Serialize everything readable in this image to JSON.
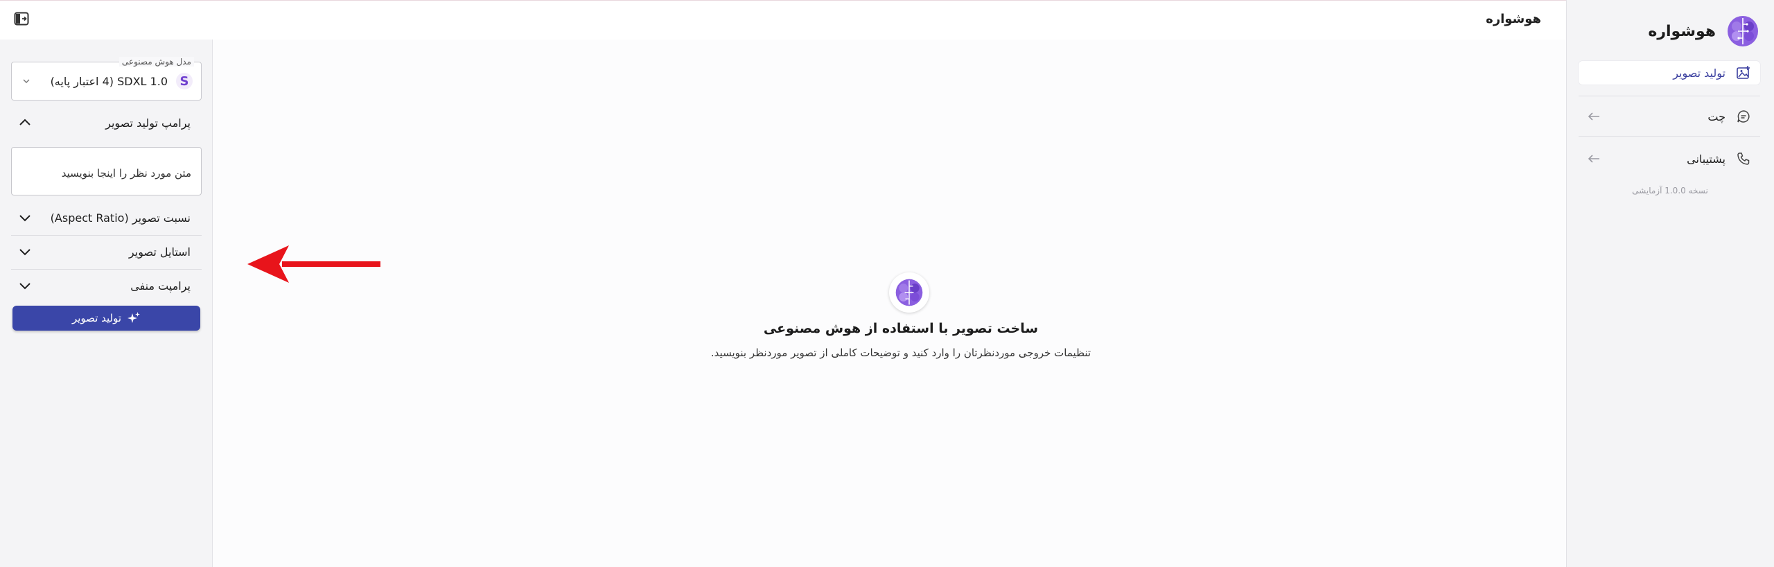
{
  "app": {
    "brand_name": "هوشواره",
    "header_title": "هوشواره",
    "version_label": "نسخه 1.0.0 آزمایشی"
  },
  "nav": {
    "items": [
      {
        "label": "تولید تصویر",
        "icon": "image-plus-icon",
        "active": true
      },
      {
        "label": "چت",
        "icon": "chat-icon",
        "active": false
      },
      {
        "label": "پشتیبانی",
        "icon": "phone-icon",
        "active": false
      }
    ]
  },
  "left_panel": {
    "model": {
      "legend": "مدل هوش مصنوعی",
      "value": "SDXL 1.0 (4 اعتبار پایه)",
      "icon_letter": "S"
    },
    "sections": {
      "prompt": "پرامپ تولید تصویر",
      "aspect_ratio": "نسبت تصویر (Aspect Ratio)",
      "style": "استایل تصویر",
      "negative_prompt": "پرامپت منفی"
    },
    "prompt_placeholder": "متن مورد نظر را اینجا بنویسید",
    "generate_button": "تولید تصویر"
  },
  "main": {
    "empty_title": "ساخت تصویر با استفاده از هوش مصنوعی",
    "empty_subtitle": "تنظیمات خروجی موردنظرتان را وارد کنید و توضیحات کاملی از تصویر موردنظر بنویسید."
  },
  "colors": {
    "accent": "#3a46a8",
    "brand_purple": "#7b4fd6",
    "annotation_arrow": "#e8141b"
  }
}
